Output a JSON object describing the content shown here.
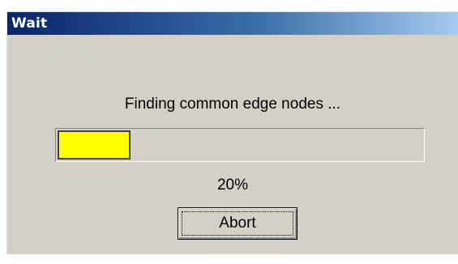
{
  "window": {
    "title": "Wait"
  },
  "dialog": {
    "message": "Finding common edge nodes ...",
    "progress": {
      "fraction": 0.2,
      "percent_text": "20%",
      "fill_color": "#ffff00"
    },
    "abort_label": "Abort"
  },
  "colors": {
    "titlebar_start": "#0a246a",
    "titlebar_end": "#a6caf0",
    "dialog_background": "#d4d0c8"
  }
}
